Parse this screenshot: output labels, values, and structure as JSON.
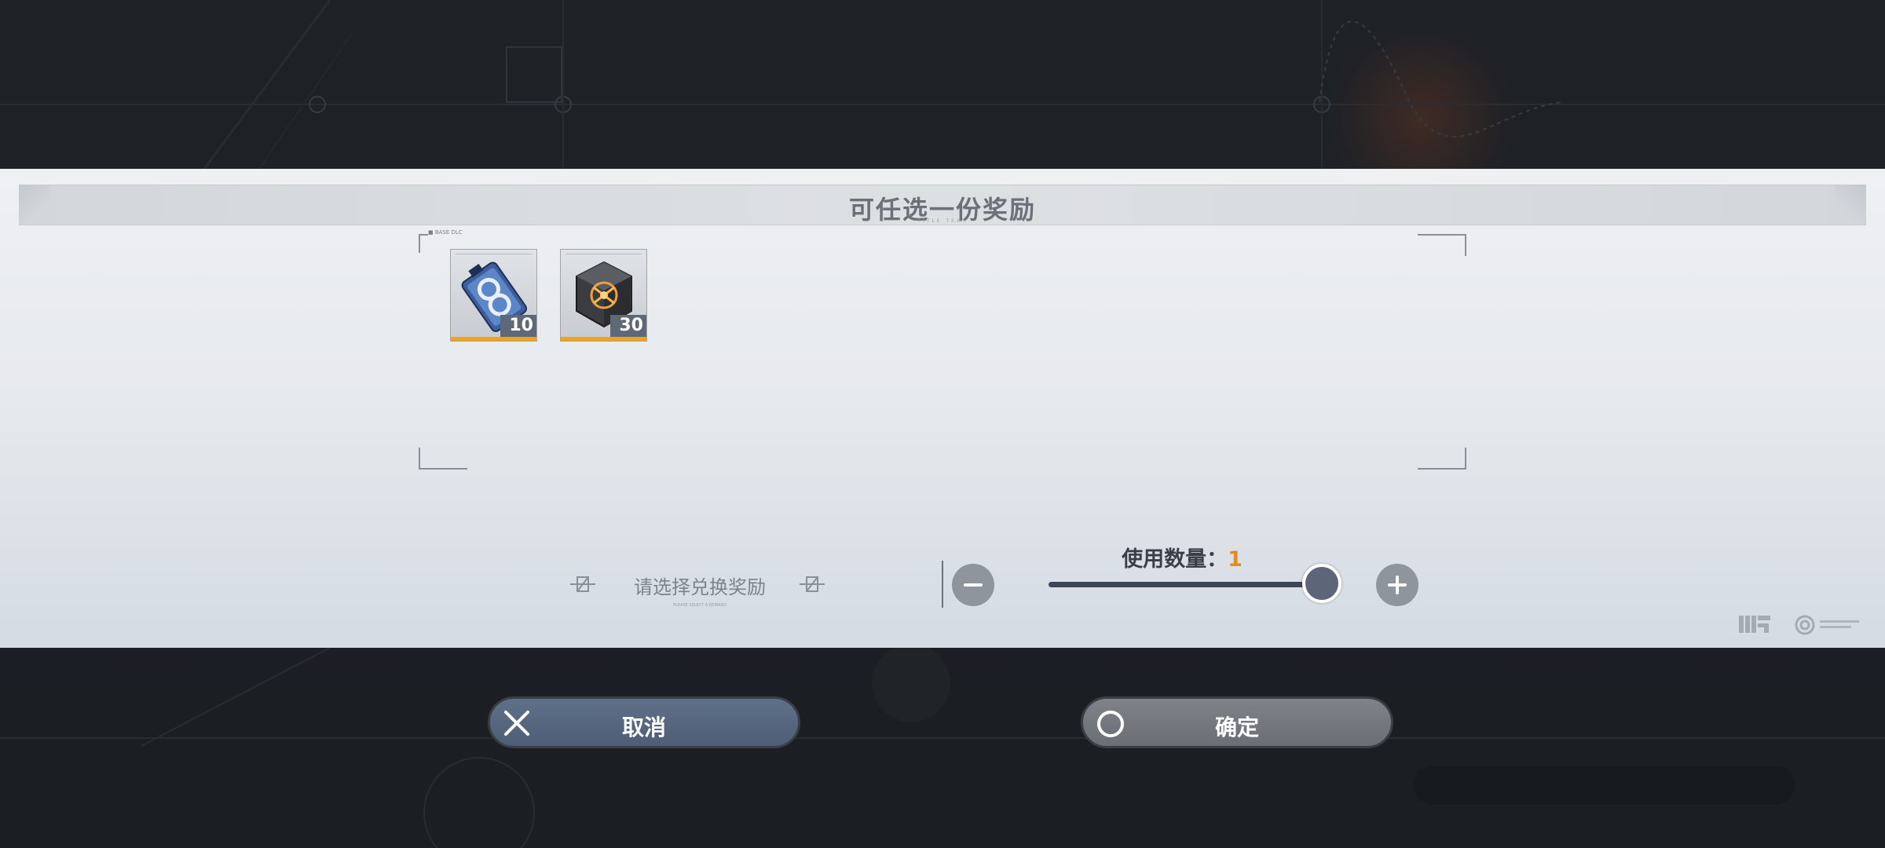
{
  "dialog": {
    "title": "可任选一份奖励",
    "title_sub": "TITLE TEXT",
    "frame_label": "■ BASE DLC"
  },
  "rewards": [
    {
      "name": "blue-material-pack",
      "count": "10"
    },
    {
      "name": "orange-core-cube",
      "count": "30"
    }
  ],
  "hint": {
    "text": "请选择兑换奖励",
    "sub": "PLEASE SELECT A REWARD"
  },
  "quantity": {
    "label": "使用数量：",
    "value": "1",
    "slider_fraction": 1.0
  },
  "buttons": {
    "cancel": "取消",
    "confirm": "确定"
  },
  "colors": {
    "accent_orange": "#e88a18",
    "item_bar": "#f0a21c",
    "cancel_bg": "#566880",
    "confirm_bg": "#75797f"
  }
}
